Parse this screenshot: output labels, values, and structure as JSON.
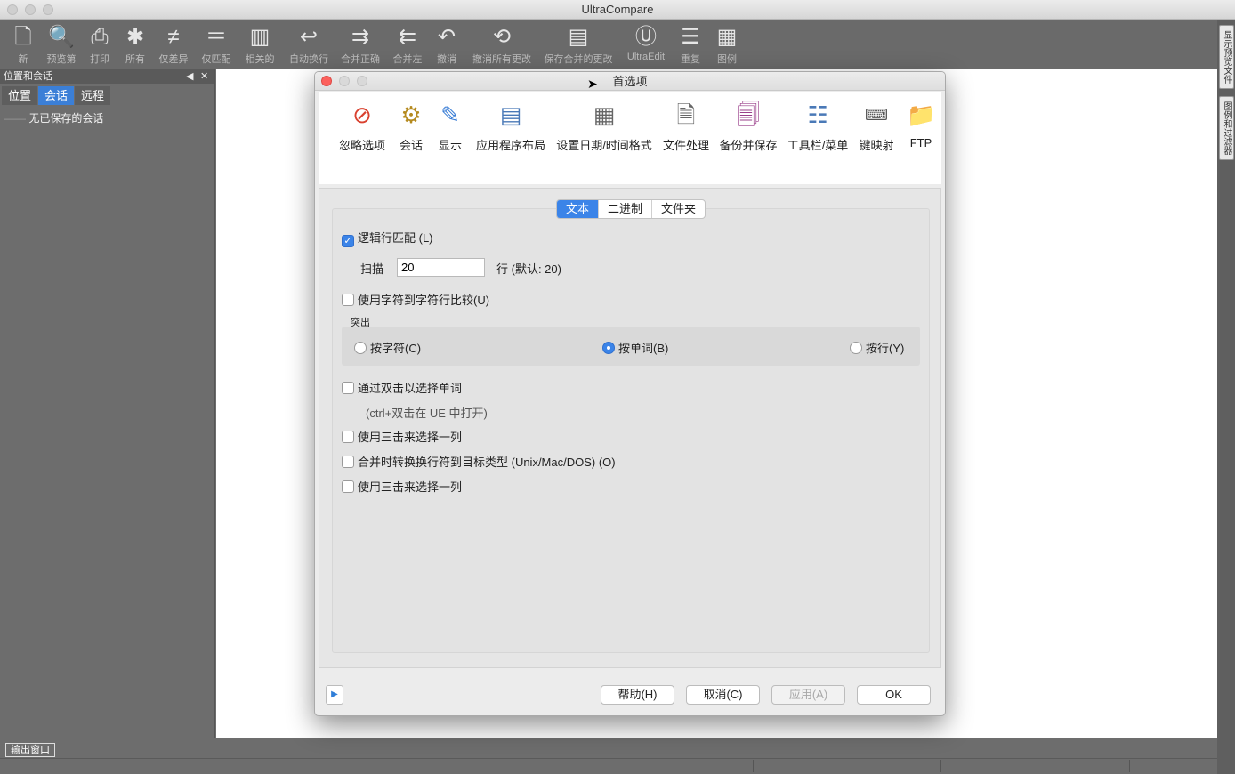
{
  "window": {
    "title": "UltraCompare"
  },
  "toolbar": {
    "items": [
      {
        "label": "新",
        "icon": "new-document-icon"
      },
      {
        "label": "预览第",
        "icon": "print-preview-icon"
      },
      {
        "label": "打印",
        "icon": "printer-icon"
      },
      {
        "label": "所有",
        "icon": "asterisk-icon"
      },
      {
        "label": "仅差异",
        "icon": "not-equal-icon"
      },
      {
        "label": "仅匹配",
        "icon": "equal-icon"
      },
      {
        "label": "相关的",
        "icon": "columns-icon"
      },
      {
        "label": "自动换行",
        "icon": "word-wrap-icon"
      },
      {
        "label": "合并正确",
        "icon": "merge-right-icon"
      },
      {
        "label": "合并左",
        "icon": "merge-left-icon"
      },
      {
        "label": "撤消",
        "icon": "undo-icon"
      },
      {
        "label": "撤消所有更改",
        "icon": "undo-all-icon"
      },
      {
        "label": "保存合并的更改",
        "icon": "save-merged-icon"
      },
      {
        "label": "UltraEdit",
        "icon": "ultraedit-logo-icon"
      },
      {
        "label": "重复",
        "icon": "repeat-icon"
      },
      {
        "label": "图例",
        "icon": "legend-icon"
      }
    ]
  },
  "right_tabs": [
    "显示预览文件",
    "图例和过滤器"
  ],
  "left_panel": {
    "title": "位置和会话",
    "tabs": [
      {
        "label": "位置",
        "active": false
      },
      {
        "label": "会话",
        "active": true
      },
      {
        "label": "远程",
        "active": false
      }
    ],
    "tree_item": "无已保存的会话"
  },
  "status": {
    "output_tab": "输出窗口"
  },
  "dialog": {
    "title": "首选项",
    "pref_items": [
      {
        "label": "忽略选项",
        "icon": "no-entry-icon"
      },
      {
        "label": "会话",
        "icon": "session-gear-icon"
      },
      {
        "label": "显示",
        "icon": "display-pencil-icon"
      },
      {
        "label": "应用程序布局",
        "icon": "app-layout-icon"
      },
      {
        "label": "设置日期/时间格式",
        "icon": "calendar-icon"
      },
      {
        "label": "文件处理",
        "icon": "file-tools-icon"
      },
      {
        "label": "备份并保存",
        "icon": "backup-save-icon"
      },
      {
        "label": "工具栏/菜单",
        "icon": "toolbar-menu-icon"
      },
      {
        "label": "键映射",
        "icon": "keyboard-keys-icon"
      },
      {
        "label": "FTP",
        "icon": "ftp-folder-icon"
      }
    ],
    "seg_tabs": [
      {
        "label": "文本",
        "selected": true
      },
      {
        "label": "二进制",
        "selected": false
      },
      {
        "label": "文件夹",
        "selected": false
      }
    ],
    "options": {
      "logical_line_match": {
        "label": "逻辑行匹配 (L)",
        "checked": true
      },
      "scan_label": "扫描",
      "scan_value": "20",
      "scan_suffix": "行 (默认: 20)",
      "char_compare": {
        "label": "使用字符到字符行比较(U)",
        "checked": false
      },
      "highlight_label": "突出",
      "highlight_options": [
        {
          "label": "按字符(C)",
          "selected": false
        },
        {
          "label": "按单词(B)",
          "selected": true
        },
        {
          "label": "按行(Y)",
          "selected": false
        }
      ],
      "double_click": {
        "label": "通过双击以选择单词",
        "checked": false
      },
      "double_click_hint": "(ctrl+双击在 UE 中打开)",
      "triple_click_1": {
        "label": "使用三击来选择一列",
        "checked": false
      },
      "convert_line_endings": {
        "label": "合并时转换换行符到目标类型 (Unix/Mac/DOS) (O)",
        "checked": false
      },
      "triple_click_2": {
        "label": "使用三击来选择一列",
        "checked": false
      }
    },
    "buttons": {
      "help": "帮助(H)",
      "cancel": "取消(C)",
      "apply": "应用(A)",
      "ok": "OK"
    }
  }
}
